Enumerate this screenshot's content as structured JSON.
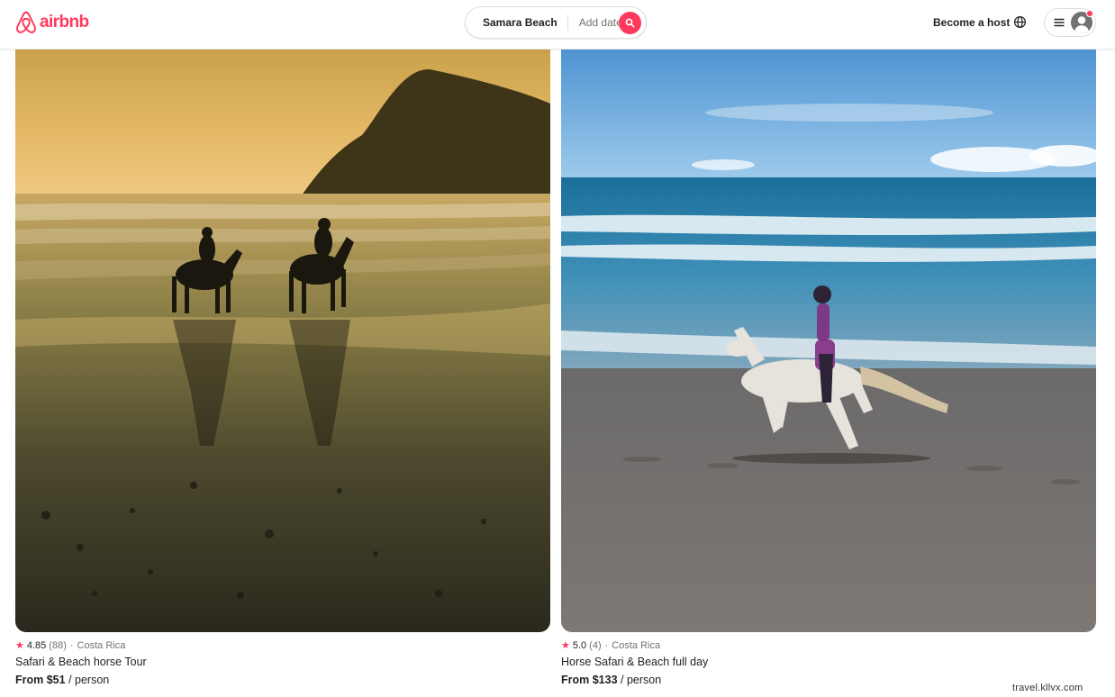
{
  "header": {
    "logo_text": "airbnb",
    "search_location": "Samara Beach",
    "search_date_placeholder": "Add date",
    "become_host_label": "Become a host"
  },
  "listings": [
    {
      "rating": "4.85",
      "reviews": "(88)",
      "separator": "·",
      "location": "Costa Rica",
      "title": "Safari & Beach horse Tour",
      "price": "From $51",
      "price_unit": "/ person"
    },
    {
      "rating": "5.0",
      "reviews": "(4)",
      "separator": "·",
      "location": "Costa Rica",
      "title": "Horse Safari & Beach full day",
      "price": "From $133",
      "price_unit": "/ person"
    }
  ],
  "watermark": "travel.kllvx.com",
  "colors": {
    "brand": "#ff385c",
    "text": "#222222",
    "muted": "#717171"
  },
  "icons": {
    "logo": "airbnb-logo-icon",
    "search": "search-icon",
    "globe": "globe-icon",
    "menu": "hamburger-icon",
    "profile": "user-avatar-icon",
    "rating": "star-icon"
  }
}
